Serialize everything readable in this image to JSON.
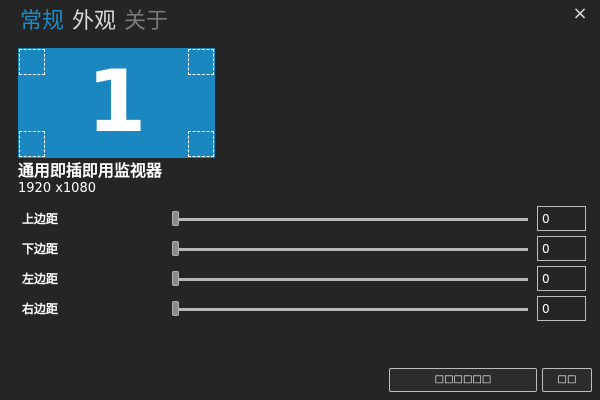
{
  "tabs": [
    {
      "label": "常规"
    },
    {
      "label": "外观"
    },
    {
      "label": "关于"
    }
  ],
  "close_glyph": "×",
  "monitor": {
    "number": "1",
    "name": "通用即插即用监视器",
    "resolution": "1920 x1080",
    "color": "#1b87c0"
  },
  "margins": [
    {
      "label": "上边距",
      "value": "0",
      "slider_fraction": 0
    },
    {
      "label": "下边距",
      "value": "0",
      "slider_fraction": 0
    },
    {
      "label": "左边距",
      "value": "0",
      "slider_fraction": 0
    },
    {
      "label": "右边距",
      "value": "0",
      "slider_fraction": 0
    }
  ],
  "buttons": {
    "reset_label": "□□□□□□",
    "ok_label": "□□"
  },
  "colors": {
    "accent": "#1e8bc3",
    "background": "#252525"
  },
  "icons": {
    "close": "close-icon"
  }
}
